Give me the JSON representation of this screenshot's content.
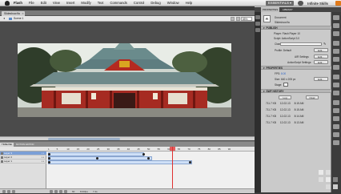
{
  "menubar": {
    "app_name": "Flash",
    "items": [
      "File",
      "Edit",
      "View",
      "Insert",
      "Modify",
      "Text",
      "Commands",
      "Control",
      "Debug",
      "Window",
      "Help"
    ],
    "workspace": "ESSENTIALS ▾",
    "brand": "Infinite Skills"
  },
  "document": {
    "tab_title": "Slideshow.fla",
    "scene_label": "Scene 1",
    "zoom": "85%"
  },
  "panel": {
    "tabs": [
      "PROPERTIES",
      "LIBRARY"
    ],
    "doc_icon": "Fl",
    "doc_type": "Document",
    "doc_name": "Slideshow.fla",
    "publish_title": "PUBLISH",
    "player_label": "Player: Flash Player 10",
    "script_label": "Script: ActionScript 3.0",
    "class_label": "Class:",
    "profile_label": "Profile: Default",
    "edit_label": "Edit...",
    "air_settings_label": "AIR Settings",
    "as_settings_label": "ActionScript Settings",
    "properties_title": "PROPERTIES",
    "fps_label": "FPS:",
    "fps_value": "8.00",
    "size_label": "Size:",
    "size_value": "640 x 205 px",
    "stage_label": "Stage:",
    "history_title": "SWF HISTORY",
    "log_label": "Log",
    "clear_label": "Clear",
    "history": [
      {
        "size": "711.7 KB",
        "date": "12-02-13",
        "time": "8:15 AM"
      },
      {
        "size": "711.7 KB",
        "date": "12-02-13",
        "time": "8:15 AM"
      },
      {
        "size": "711.7 KB",
        "date": "12-02-13",
        "time": "8:14 AM"
      },
      {
        "size": "711.7 KB",
        "date": "12-02-13",
        "time": "8:13 AM"
      }
    ]
  },
  "timeline": {
    "tabs": [
      "TIMELINE",
      "MOTION EDITOR"
    ],
    "layers": [
      "Layer 3",
      "Layer 2",
      "Layer 1"
    ],
    "ticks": [
      "1",
      "5",
      "10",
      "15",
      "20",
      "25",
      "30",
      "35",
      "40",
      "45",
      "50",
      "55",
      "60",
      "65",
      "70",
      "75",
      "80",
      "85",
      "90"
    ],
    "frame_readout": "60",
    "fps_readout": "8.00fps",
    "time_readout": "7.4s"
  }
}
